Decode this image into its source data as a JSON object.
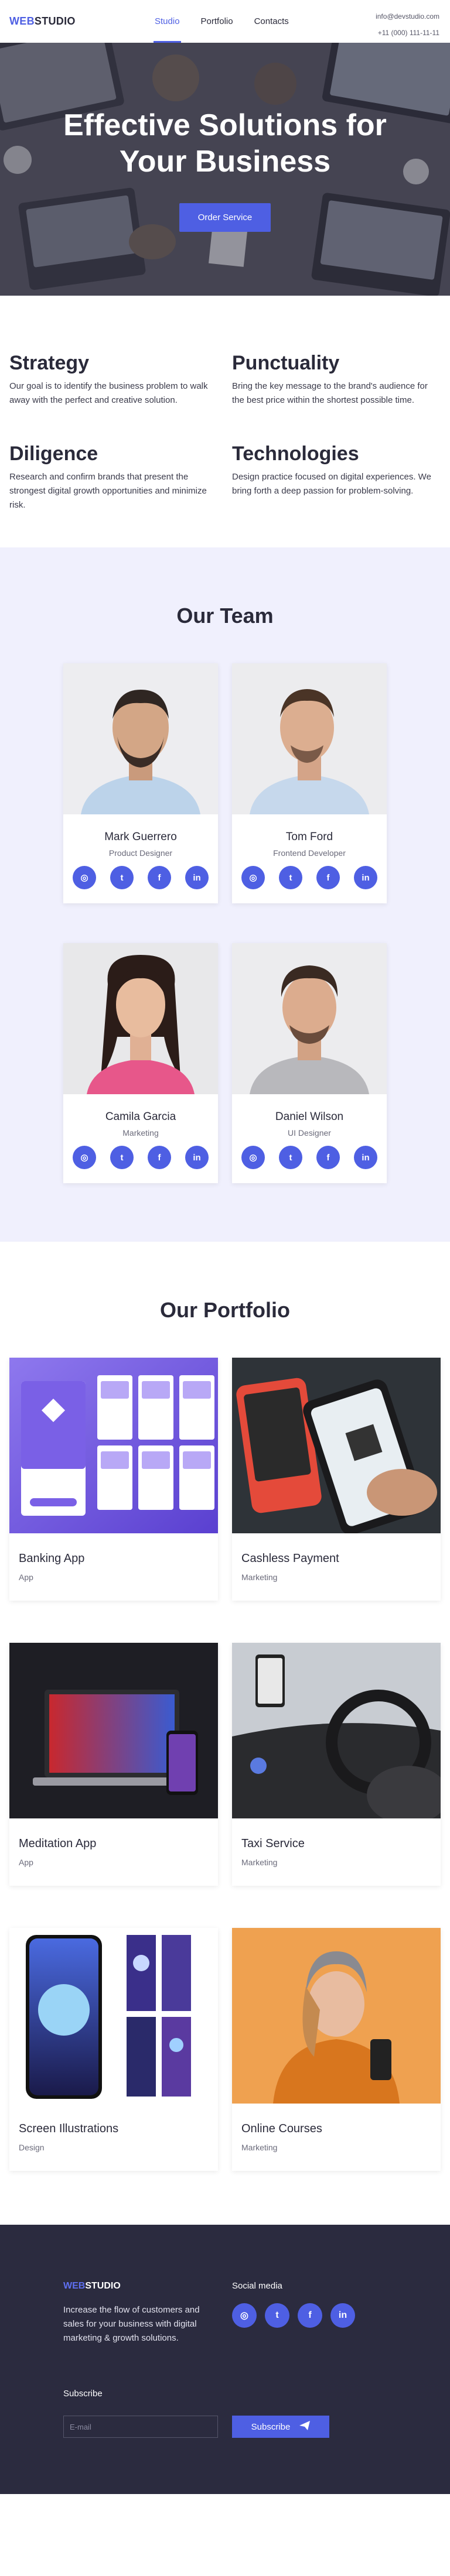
{
  "brand": {
    "part1": "WEB",
    "part2": "STUDIO",
    "accent": "#4e5fe3"
  },
  "nav": [
    {
      "label": "Studio",
      "active": true
    },
    {
      "label": "Portfolio",
      "active": false
    },
    {
      "label": "Contacts",
      "active": false
    }
  ],
  "header": {
    "email": "info@devstudio.com",
    "phone": "+11 (000) 111-11-11"
  },
  "hero": {
    "title": "Effective Solutions for Your Business",
    "button": "Order Service"
  },
  "features": [
    {
      "title": "Strategy",
      "text": "Our goal is to identify the business problem to walk away with the perfect and creative solution."
    },
    {
      "title": "Punctuality",
      "text": "Bring the key message to the brand's audience for the best price within the shortest possible time."
    },
    {
      "title": "Diligence",
      "text": "Research and confirm brands that present the strongest digital growth opportunities and minimize risk."
    },
    {
      "title": "Technologies",
      "text": "Design practice focused on digital experiences. We bring forth a deep passion for problem-solving."
    }
  ],
  "team": {
    "title": "Our Team",
    "members": [
      {
        "name": "Mark Guerrero",
        "role": "Product Designer"
      },
      {
        "name": "Tom Ford",
        "role": "Frontend Developer"
      },
      {
        "name": "Camila Garcia",
        "role": "Marketing"
      },
      {
        "name": "Daniel Wilson",
        "role": "UI Designer"
      }
    ],
    "social_icons": [
      "instagram-icon",
      "twitter-icon",
      "facebook-icon",
      "linkedin-icon"
    ]
  },
  "portfolio": {
    "title": "Our Portfolio",
    "projects": [
      {
        "title": "Banking App",
        "category": "App"
      },
      {
        "title": "Cashless Payment",
        "category": "Marketing"
      },
      {
        "title": "Meditation App",
        "category": "App"
      },
      {
        "title": "Taxi Service",
        "category": "Marketing"
      },
      {
        "title": "Screen Illustrations",
        "category": "Design"
      },
      {
        "title": "Online Courses",
        "category": "Marketing"
      }
    ]
  },
  "footer": {
    "description": "Increase the flow of customers and sales for your business with digital marketing & growth solutions.",
    "social_title": "Social media",
    "subscribe_title": "Subscribe",
    "email_placeholder": "E-mail",
    "subscribe_button": "Subscribe",
    "background": "#2b2b3f"
  }
}
